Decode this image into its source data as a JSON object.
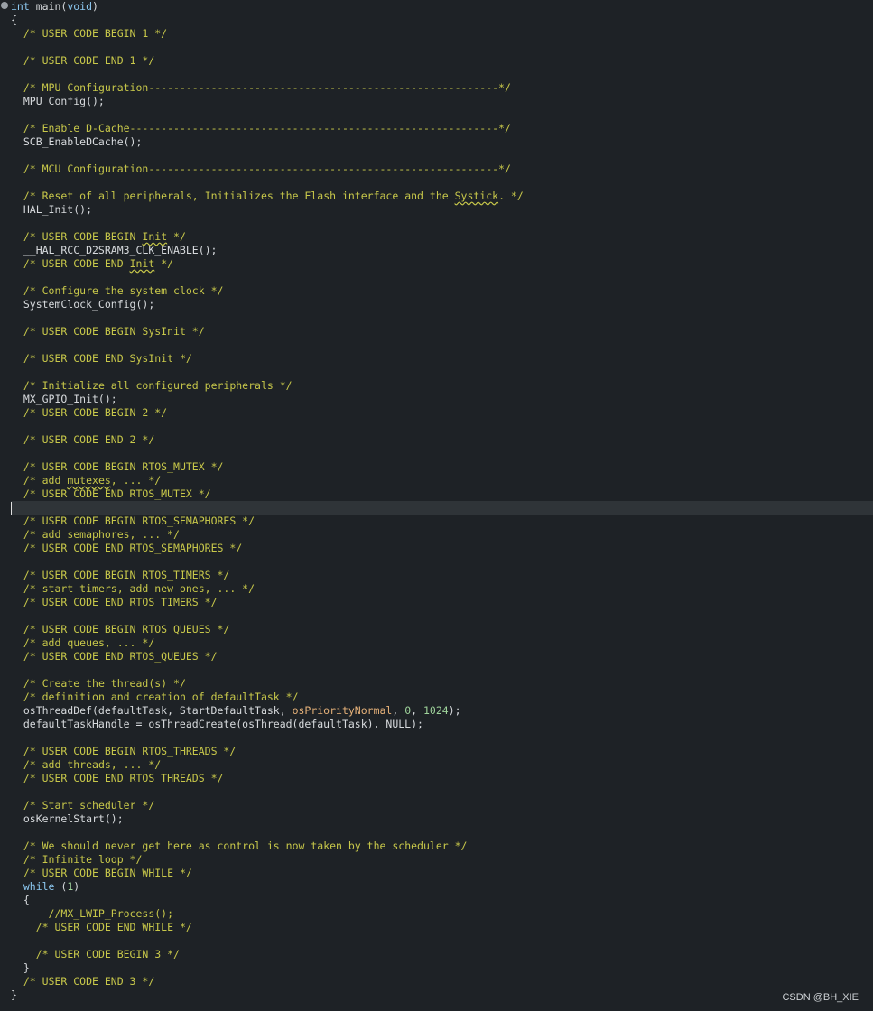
{
  "editor": {
    "lines": [
      {
        "t": [
          [
            "kw",
            "int"
          ],
          [
            "plain",
            " main("
          ],
          [
            "kw",
            "void"
          ],
          [
            "plain",
            ")"
          ]
        ]
      },
      {
        "t": [
          [
            "plain",
            "{"
          ]
        ]
      },
      {
        "t": [
          [
            "plain",
            "  "
          ],
          [
            "comment",
            "/* USER CODE BEGIN 1 */"
          ]
        ]
      },
      {
        "t": []
      },
      {
        "t": [
          [
            "plain",
            "  "
          ],
          [
            "comment",
            "/* USER CODE END 1 */"
          ]
        ]
      },
      {
        "t": []
      },
      {
        "t": [
          [
            "plain",
            "  "
          ],
          [
            "comment",
            "/* MPU Configuration--------------------------------------------------------*/"
          ]
        ]
      },
      {
        "t": [
          [
            "plain",
            "  MPU_Config();"
          ]
        ]
      },
      {
        "t": []
      },
      {
        "t": [
          [
            "plain",
            "  "
          ],
          [
            "comment",
            "/* Enable D-Cache-----------------------------------------------------------*/"
          ]
        ]
      },
      {
        "t": [
          [
            "plain",
            "  SCB_EnableDCache();"
          ]
        ]
      },
      {
        "t": []
      },
      {
        "t": [
          [
            "plain",
            "  "
          ],
          [
            "comment",
            "/* MCU Configuration--------------------------------------------------------*/"
          ]
        ]
      },
      {
        "t": []
      },
      {
        "t": [
          [
            "plain",
            "  "
          ],
          [
            "comment",
            "/* Reset of all peripherals, Initializes the Flash interface and the "
          ],
          [
            "commentsq",
            "Systick"
          ],
          [
            "comment",
            ". */"
          ]
        ]
      },
      {
        "t": [
          [
            "plain",
            "  HAL_Init();"
          ]
        ]
      },
      {
        "t": []
      },
      {
        "t": [
          [
            "plain",
            "  "
          ],
          [
            "comment",
            "/* USER CODE BEGIN "
          ],
          [
            "commentsq",
            "Init"
          ],
          [
            "comment",
            " */"
          ]
        ]
      },
      {
        "t": [
          [
            "plain",
            "  __HAL_RCC_D2SRAM3_CLK_ENABLE();"
          ]
        ]
      },
      {
        "t": [
          [
            "plain",
            "  "
          ],
          [
            "comment",
            "/* USER CODE END "
          ],
          [
            "commentsq",
            "Init"
          ],
          [
            "comment",
            " */"
          ]
        ]
      },
      {
        "t": []
      },
      {
        "t": [
          [
            "plain",
            "  "
          ],
          [
            "comment",
            "/* Configure the system clock */"
          ]
        ]
      },
      {
        "t": [
          [
            "plain",
            "  SystemClock_Config();"
          ]
        ]
      },
      {
        "t": []
      },
      {
        "t": [
          [
            "plain",
            "  "
          ],
          [
            "comment",
            "/* USER CODE BEGIN SysInit */"
          ]
        ]
      },
      {
        "t": []
      },
      {
        "t": [
          [
            "plain",
            "  "
          ],
          [
            "comment",
            "/* USER CODE END SysInit */"
          ]
        ]
      },
      {
        "t": []
      },
      {
        "t": [
          [
            "plain",
            "  "
          ],
          [
            "comment",
            "/* Initialize all configured peripherals */"
          ]
        ]
      },
      {
        "t": [
          [
            "plain",
            "  MX_GPIO_Init();"
          ]
        ]
      },
      {
        "t": [
          [
            "plain",
            "  "
          ],
          [
            "comment",
            "/* USER CODE BEGIN 2 */"
          ]
        ]
      },
      {
        "t": []
      },
      {
        "t": [
          [
            "plain",
            "  "
          ],
          [
            "comment",
            "/* USER CODE END 2 */"
          ]
        ]
      },
      {
        "t": []
      },
      {
        "t": [
          [
            "plain",
            "  "
          ],
          [
            "comment",
            "/* USER CODE BEGIN RTOS_MUTEX */"
          ]
        ]
      },
      {
        "t": [
          [
            "plain",
            "  "
          ],
          [
            "comment",
            "/* add "
          ],
          [
            "commentsq",
            "mutexes"
          ],
          [
            "comment",
            ", ... */"
          ]
        ]
      },
      {
        "t": [
          [
            "plain",
            "  "
          ],
          [
            "comment",
            "/* USER CODE END RTOS_MUTEX */"
          ]
        ]
      },
      {
        "t": [],
        "current": true
      },
      {
        "t": [
          [
            "plain",
            "  "
          ],
          [
            "comment",
            "/* USER CODE BEGIN RTOS_SEMAPHORES */"
          ]
        ]
      },
      {
        "t": [
          [
            "plain",
            "  "
          ],
          [
            "comment",
            "/* add semaphores, ... */"
          ]
        ]
      },
      {
        "t": [
          [
            "plain",
            "  "
          ],
          [
            "comment",
            "/* USER CODE END RTOS_SEMAPHORES */"
          ]
        ]
      },
      {
        "t": []
      },
      {
        "t": [
          [
            "plain",
            "  "
          ],
          [
            "comment",
            "/* USER CODE BEGIN RTOS_TIMERS */"
          ]
        ]
      },
      {
        "t": [
          [
            "plain",
            "  "
          ],
          [
            "comment",
            "/* start timers, add new ones, ... */"
          ]
        ]
      },
      {
        "t": [
          [
            "plain",
            "  "
          ],
          [
            "comment",
            "/* USER CODE END RTOS_TIMERS */"
          ]
        ]
      },
      {
        "t": []
      },
      {
        "t": [
          [
            "plain",
            "  "
          ],
          [
            "comment",
            "/* USER CODE BEGIN RTOS_QUEUES */"
          ]
        ]
      },
      {
        "t": [
          [
            "plain",
            "  "
          ],
          [
            "comment",
            "/* add queues, ... */"
          ]
        ]
      },
      {
        "t": [
          [
            "plain",
            "  "
          ],
          [
            "comment",
            "/* USER CODE END RTOS_QUEUES */"
          ]
        ]
      },
      {
        "t": []
      },
      {
        "t": [
          [
            "plain",
            "  "
          ],
          [
            "comment",
            "/* Create the thread(s) */"
          ]
        ]
      },
      {
        "t": [
          [
            "plain",
            "  "
          ],
          [
            "comment",
            "/* definition and creation of defaultTask */"
          ]
        ]
      },
      {
        "t": [
          [
            "plain",
            "  osThreadDef(defaultTask, StartDefaultTask, "
          ],
          [
            "enum",
            "osPriorityNormal"
          ],
          [
            "plain",
            ", "
          ],
          [
            "num",
            "0"
          ],
          [
            "plain",
            ", "
          ],
          [
            "num",
            "1024"
          ],
          [
            "plain",
            ");"
          ]
        ]
      },
      {
        "t": [
          [
            "plain",
            "  defaultTaskHandle = osThreadCreate(osThread(defaultTask), NULL);"
          ]
        ]
      },
      {
        "t": []
      },
      {
        "t": [
          [
            "plain",
            "  "
          ],
          [
            "comment",
            "/* USER CODE BEGIN RTOS_THREADS */"
          ]
        ]
      },
      {
        "t": [
          [
            "plain",
            "  "
          ],
          [
            "comment",
            "/* add threads, ... */"
          ]
        ]
      },
      {
        "t": [
          [
            "plain",
            "  "
          ],
          [
            "comment",
            "/* USER CODE END RTOS_THREADS */"
          ]
        ]
      },
      {
        "t": []
      },
      {
        "t": [
          [
            "plain",
            "  "
          ],
          [
            "comment",
            "/* Start scheduler */"
          ]
        ]
      },
      {
        "t": [
          [
            "plain",
            "  osKernelStart();"
          ]
        ]
      },
      {
        "t": []
      },
      {
        "t": [
          [
            "plain",
            "  "
          ],
          [
            "comment",
            "/* We should never get here as control is now taken by the scheduler */"
          ]
        ]
      },
      {
        "t": [
          [
            "plain",
            "  "
          ],
          [
            "comment",
            "/* Infinite loop */"
          ]
        ]
      },
      {
        "t": [
          [
            "plain",
            "  "
          ],
          [
            "comment",
            "/* USER CODE BEGIN WHILE */"
          ]
        ]
      },
      {
        "t": [
          [
            "plain",
            "  "
          ],
          [
            "kw",
            "while"
          ],
          [
            "plain",
            " ("
          ],
          [
            "num",
            "1"
          ],
          [
            "plain",
            ")"
          ]
        ]
      },
      {
        "t": [
          [
            "plain",
            "  {"
          ]
        ]
      },
      {
        "t": [
          [
            "plain",
            "      "
          ],
          [
            "comment",
            "//MX_LWIP_Process();"
          ]
        ]
      },
      {
        "t": [
          [
            "plain",
            "    "
          ],
          [
            "comment",
            "/* USER CODE END WHILE */"
          ]
        ]
      },
      {
        "t": []
      },
      {
        "t": [
          [
            "plain",
            "    "
          ],
          [
            "comment",
            "/* USER CODE BEGIN 3 */"
          ]
        ]
      },
      {
        "t": [
          [
            "plain",
            "  }"
          ]
        ]
      },
      {
        "t": [
          [
            "plain",
            "  "
          ],
          [
            "comment",
            "/* USER CODE END 3 */"
          ]
        ]
      },
      {
        "t": [
          [
            "plain",
            "}"
          ]
        ]
      }
    ]
  },
  "fold_marker": "−",
  "watermark": "CSDN @BH_XIE"
}
